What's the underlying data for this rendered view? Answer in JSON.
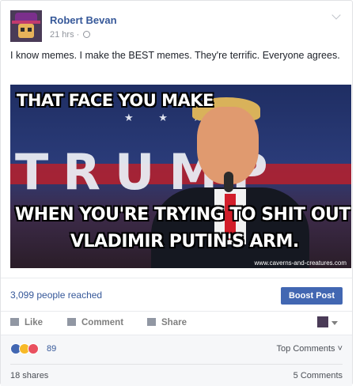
{
  "post": {
    "author": "Robert Bevan",
    "time": "21 hrs ·",
    "privacy_icon": "globe-icon",
    "text": "I know memes. I make the BEST memes. They're terrific. Everyone agrees."
  },
  "meme": {
    "top_text": "THAT FACE YOU MAKE",
    "background_word": "TRUMP",
    "bottom_text_line1": "WHEN YOU'RE TRYING TO SHIT OUT",
    "bottom_text_line2": "VLADIMIR PUTIN'S ARM.",
    "watermark": "www.caverns-and-creatures.com",
    "stars": "★ ★ ★"
  },
  "insights": {
    "reach": "3,099 people reached",
    "boost_label": "Boost Post"
  },
  "actions": {
    "like": "Like",
    "comment": "Comment",
    "share": "Share"
  },
  "footer": {
    "reaction_count": "89",
    "top_comments": "Top Comments ˅",
    "shares": "18 shares",
    "comments": "5 Comments"
  },
  "colors": {
    "link": "#365899",
    "boost": "#4267b2",
    "meta": "#90949c"
  }
}
